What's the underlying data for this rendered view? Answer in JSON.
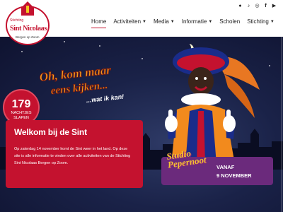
{
  "logo": {
    "stichting": "Stichting",
    "name": "Sint Nicolaas",
    "place": "Bergen op Zoom"
  },
  "social": [
    {
      "icon": "spotify-icon",
      "glyph": "●"
    },
    {
      "icon": "tiktok-icon",
      "glyph": "♪"
    },
    {
      "icon": "instagram-icon",
      "glyph": "◎"
    },
    {
      "icon": "facebook-icon",
      "glyph": "f"
    },
    {
      "icon": "youtube-icon",
      "glyph": "▶"
    }
  ],
  "nav": [
    {
      "label": "Home",
      "active": true,
      "dropdown": false
    },
    {
      "label": "Activiteiten",
      "active": false,
      "dropdown": true
    },
    {
      "label": "Media",
      "active": false,
      "dropdown": true
    },
    {
      "label": "Informatie",
      "active": false,
      "dropdown": true
    },
    {
      "label": "Scholen",
      "active": false,
      "dropdown": false
    },
    {
      "label": "Stichting",
      "active": false,
      "dropdown": true
    }
  ],
  "tagline": {
    "line1": "Oh, kom maar",
    "line2": "eens kijken...",
    "line3": "...wat ik kan!"
  },
  "countdown": {
    "number": "179",
    "label_line1": "NACHTJES",
    "label_line2": "SLAPEN"
  },
  "welcome": {
    "title": "Welkom bij de Sint",
    "text": "Op zaterdag 14 november komt de Sint weer in het land. Op deze site is alle informatie te vinden over alle activiteiten van de Stichting Sint Nicolaas Bergen op Zoom."
  },
  "studio": {
    "logo_line1": "Studio",
    "logo_line2": "Pepernoot",
    "vanaf": "VANAF",
    "date": "9 NOVEMBER"
  },
  "colors": {
    "brand_red": "#c4122f",
    "studio_purple": "#6b2a7c",
    "tagline_orange": "#f39a1e"
  }
}
